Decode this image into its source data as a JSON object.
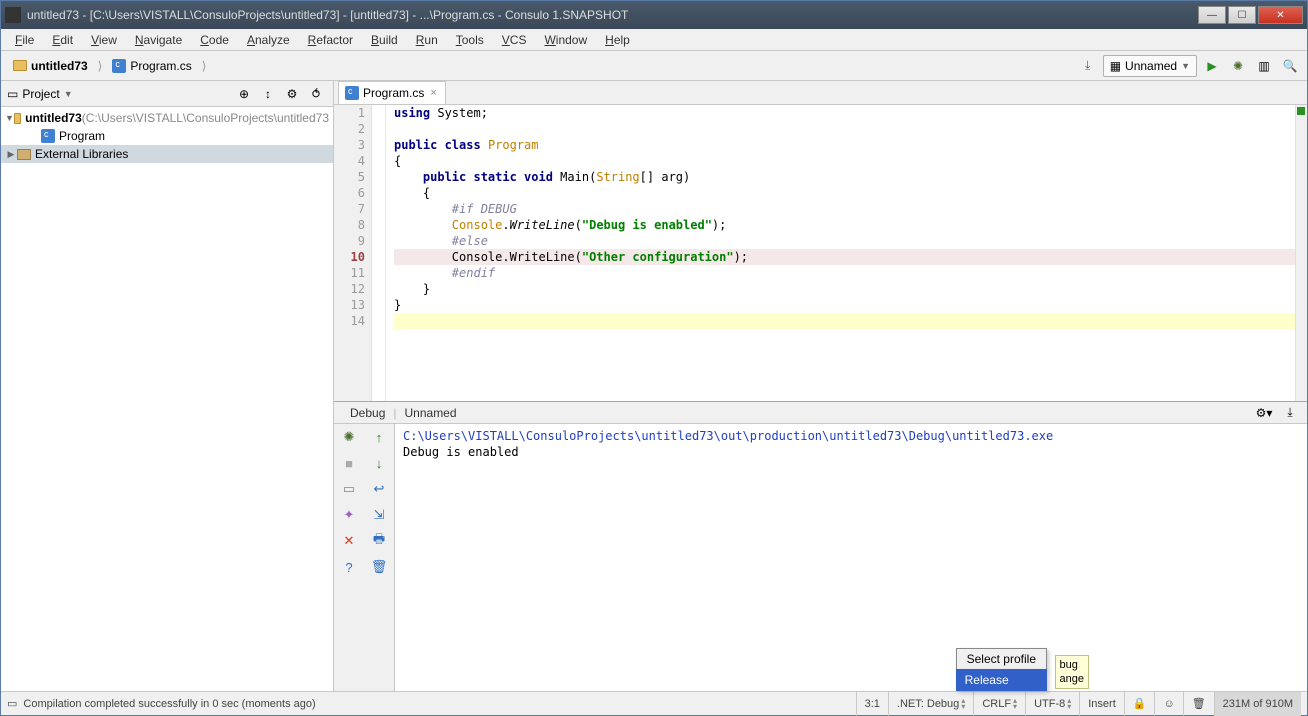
{
  "title": "untitled73 - [C:\\Users\\VISTALL\\ConsuloProjects\\untitled73] - [untitled73] - ...\\Program.cs - Consulo 1.SNAPSHOT",
  "menu": [
    "File",
    "Edit",
    "View",
    "Navigate",
    "Code",
    "Analyze",
    "Refactor",
    "Build",
    "Run",
    "Tools",
    "VCS",
    "Window",
    "Help"
  ],
  "breadcrumb": [
    {
      "icon": "folder",
      "label": "untitled73"
    },
    {
      "icon": "cs",
      "label": "Program.cs"
    }
  ],
  "runconfig": {
    "label": "Unnamed"
  },
  "sidebar": {
    "title": "Project",
    "tree": [
      {
        "indent": 0,
        "arrow": "▼",
        "icon": "folder",
        "bold": true,
        "label": "untitled73",
        "suffix": " (C:\\Users\\VISTALL\\ConsuloProjects\\untitled73"
      },
      {
        "indent": 2,
        "arrow": "",
        "icon": "cs",
        "label": "Program"
      },
      {
        "indent": 0,
        "arrow": "▶",
        "icon": "lib",
        "label": "External Libraries",
        "selected": true
      }
    ]
  },
  "editor": {
    "tab": {
      "label": "Program.cs"
    },
    "lines": [
      {
        "n": 1,
        "html": "<span class='kw'>using</span> System;"
      },
      {
        "n": 2,
        "html": ""
      },
      {
        "n": 3,
        "html": "<span class='kw'>public class</span> <span class='cls'>Program</span>"
      },
      {
        "n": 4,
        "html": "{"
      },
      {
        "n": 5,
        "html": "<span class='guide'>····</span><span class='kw'>public static void</span> Main(<span class='cls'>String</span>[] arg)"
      },
      {
        "n": 6,
        "html": "<span class='guide'>····</span>{"
      },
      {
        "n": 7,
        "html": "<span class='guide'>········</span><span class='pp'>#if DEBUG</span>"
      },
      {
        "n": 8,
        "html": "<span class='guide'>········</span><span class='cls'>Console</span>.<span style='font-style:italic'>WriteLine</span>(<span class='str'>\"Debug is enabled\"</span>);"
      },
      {
        "n": 9,
        "html": "<span class='guide'>········</span><span class='pp'>#else</span>"
      },
      {
        "n": 10,
        "html": "<span class='guide'>········</span>Console.WriteLine(<span class='str'>\"Other configuration\"</span>);",
        "err": true
      },
      {
        "n": 11,
        "html": "<span class='guide'>········</span><span class='pp'>#endif</span>"
      },
      {
        "n": 12,
        "html": "<span class='guide'>····</span>}"
      },
      {
        "n": 13,
        "html": "}"
      },
      {
        "n": 14,
        "html": "",
        "hl": true
      }
    ]
  },
  "debug": {
    "tab1": "Debug",
    "tab2": "Unnamed",
    "console_path": "C:\\Users\\VISTALL\\ConsuloProjects\\untitled73\\out\\production\\untitled73\\Debug\\untitled73.exe",
    "console_out": "Debug is enabled"
  },
  "popup": {
    "title": "Select profile",
    "item": "Release"
  },
  "tooltip_lines": [
    "bug",
    "ange"
  ],
  "status": {
    "msg": "Compilation completed successfully in 0 sec (moments ago)",
    "pos": "3:1",
    "profile": ".NET: Debug",
    "eol": "CRLF",
    "enc": "UTF-8",
    "ins": "Insert",
    "mem": "231M of 910M"
  }
}
